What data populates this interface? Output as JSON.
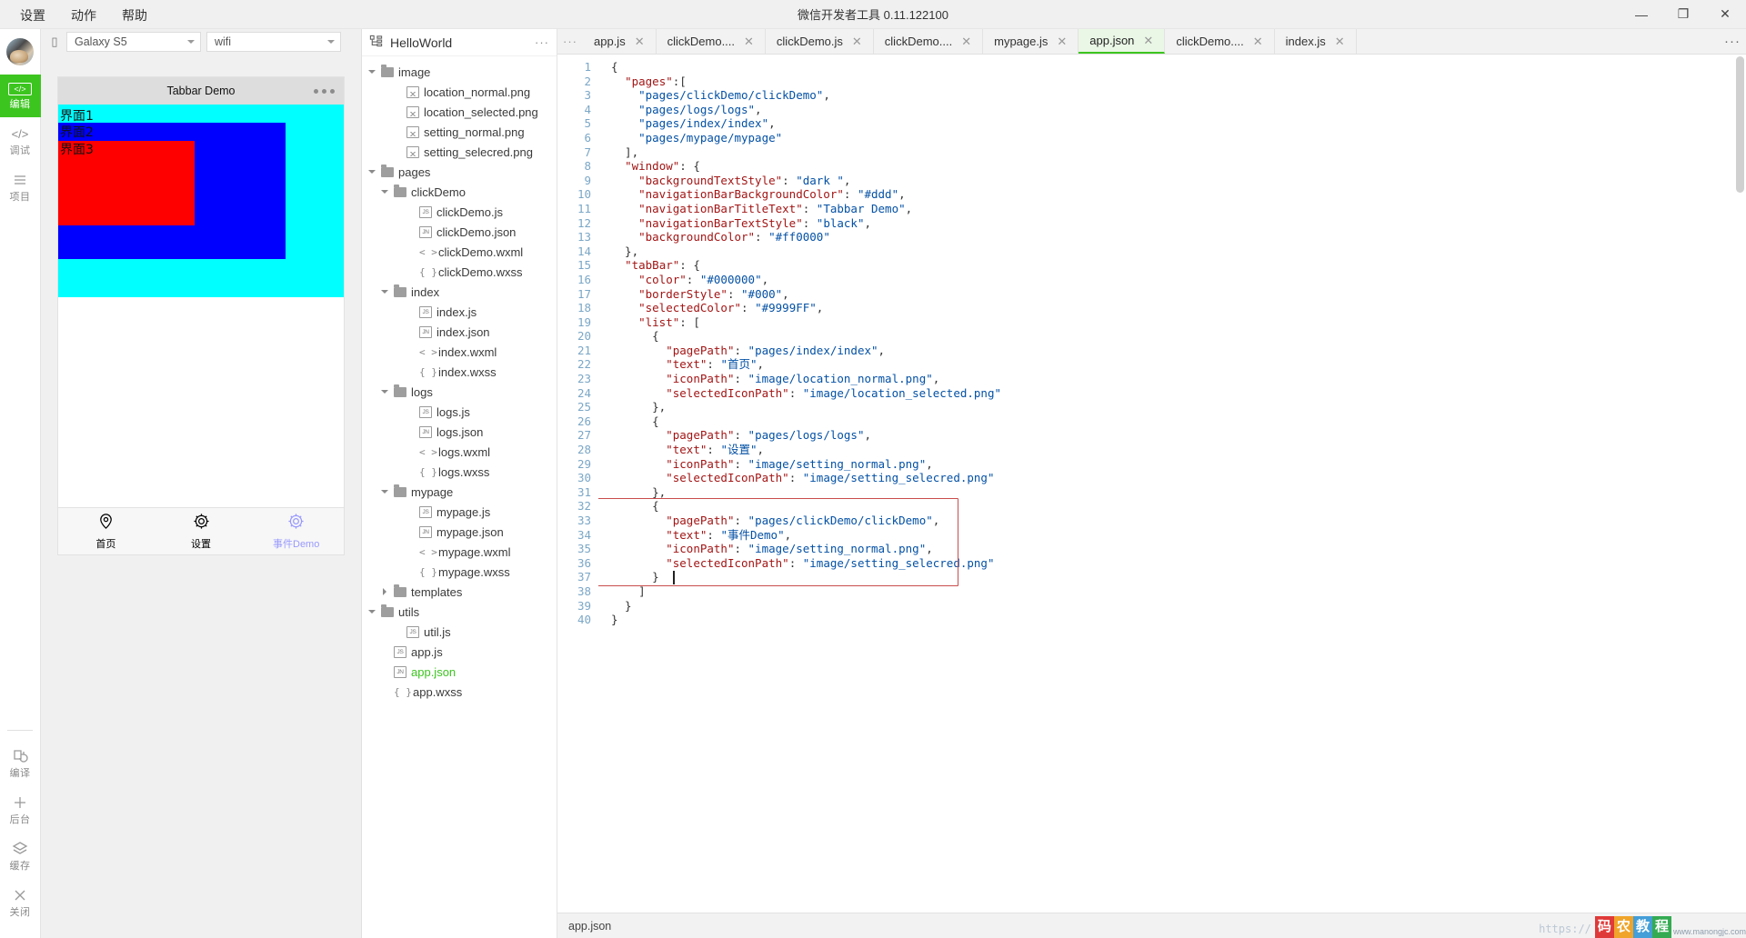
{
  "window": {
    "title": "微信开发者工具 0.11.122100",
    "controls": {
      "minimize": "—",
      "maximize": "❐",
      "close": "✕"
    }
  },
  "menubar": {
    "items": [
      "设置",
      "动作",
      "帮助"
    ]
  },
  "rail": {
    "items": [
      {
        "label": "编辑",
        "icon": "code-brackets-icon",
        "active": true
      },
      {
        "label": "调试",
        "icon": "debug-icon",
        "active": false
      },
      {
        "label": "项目",
        "icon": "project-list-icon",
        "active": false
      }
    ],
    "bottom_items": [
      {
        "label": "编译",
        "icon": "compile-refresh-icon"
      },
      {
        "label": "后台",
        "icon": "background-icon"
      },
      {
        "label": "缓存",
        "icon": "cache-layers-icon"
      },
      {
        "label": "关闭",
        "icon": "close-x-icon"
      }
    ]
  },
  "simulator": {
    "device": "Galaxy S5",
    "network": "wifi",
    "nav_title": "Tabbar Demo",
    "page_labels": [
      "界面1",
      "界面2",
      "界面3"
    ],
    "colors": {
      "cyan": "#00ffff",
      "blue": "#0000ff",
      "red": "#ff0000",
      "nav_bg": "#dddddd"
    },
    "tabbar": [
      {
        "text": "首页",
        "icon": "location-pin-icon",
        "selected": false
      },
      {
        "text": "设置",
        "icon": "gear-icon",
        "selected": false
      },
      {
        "text": "事件Demo",
        "icon": "gear-icon",
        "selected": true
      }
    ],
    "tabbar_selected_color": "#9999FF"
  },
  "tree": {
    "project_name": "HelloWorld",
    "more_label": "···",
    "nodes": [
      {
        "label": "image",
        "type": "folder",
        "depth": 0,
        "expanded": true
      },
      {
        "label": "location_normal.png",
        "type": "image",
        "depth": 2
      },
      {
        "label": "location_selected.png",
        "type": "image",
        "depth": 2
      },
      {
        "label": "setting_normal.png",
        "type": "image",
        "depth": 2
      },
      {
        "label": "setting_selecred.png",
        "type": "image",
        "depth": 2
      },
      {
        "label": "pages",
        "type": "folder",
        "depth": 0,
        "expanded": true
      },
      {
        "label": "clickDemo",
        "type": "folder",
        "depth": 1,
        "expanded": true
      },
      {
        "label": "clickDemo.js",
        "type": "js",
        "depth": 3
      },
      {
        "label": "clickDemo.json",
        "type": "jn",
        "depth": 3
      },
      {
        "label": "clickDemo.wxml",
        "type": "wxml",
        "depth": 3
      },
      {
        "label": "clickDemo.wxss",
        "type": "wxss",
        "depth": 3
      },
      {
        "label": "index",
        "type": "folder",
        "depth": 1,
        "expanded": true
      },
      {
        "label": "index.js",
        "type": "js",
        "depth": 3
      },
      {
        "label": "index.json",
        "type": "jn",
        "depth": 3
      },
      {
        "label": "index.wxml",
        "type": "wxml",
        "depth": 3
      },
      {
        "label": "index.wxss",
        "type": "wxss",
        "depth": 3
      },
      {
        "label": "logs",
        "type": "folder",
        "depth": 1,
        "expanded": true
      },
      {
        "label": "logs.js",
        "type": "js",
        "depth": 3
      },
      {
        "label": "logs.json",
        "type": "jn",
        "depth": 3
      },
      {
        "label": "logs.wxml",
        "type": "wxml",
        "depth": 3
      },
      {
        "label": "logs.wxss",
        "type": "wxss",
        "depth": 3
      },
      {
        "label": "mypage",
        "type": "folder",
        "depth": 1,
        "expanded": true
      },
      {
        "label": "mypage.js",
        "type": "js",
        "depth": 3
      },
      {
        "label": "mypage.json",
        "type": "jn",
        "depth": 3
      },
      {
        "label": "mypage.wxml",
        "type": "wxml",
        "depth": 3
      },
      {
        "label": "mypage.wxss",
        "type": "wxss",
        "depth": 3
      },
      {
        "label": "templates",
        "type": "folder",
        "depth": 1,
        "expanded": false
      },
      {
        "label": "utils",
        "type": "folder",
        "depth": 0,
        "expanded": true
      },
      {
        "label": "util.js",
        "type": "js",
        "depth": 2
      },
      {
        "label": "app.js",
        "type": "js",
        "depth": 1
      },
      {
        "label": "app.json",
        "type": "jn",
        "depth": 1,
        "selected": true
      },
      {
        "label": "app.wxss",
        "type": "wxss",
        "depth": 1
      }
    ]
  },
  "editor": {
    "more_left": "···",
    "more_right": "···",
    "tabs": [
      {
        "label": "app.js",
        "active": false
      },
      {
        "label": "clickDemo....",
        "active": false
      },
      {
        "label": "clickDemo.js",
        "active": false
      },
      {
        "label": "clickDemo....",
        "active": false
      },
      {
        "label": "mypage.js",
        "active": false
      },
      {
        "label": "app.json",
        "active": true
      },
      {
        "label": "clickDemo....",
        "active": false
      },
      {
        "label": "index.js",
        "active": false
      }
    ],
    "close_glyph": "✕",
    "lines": [
      "{",
      "  \"pages\":[",
      "    \"pages/clickDemo/clickDemo\",",
      "    \"pages/logs/logs\",",
      "    \"pages/index/index\",",
      "    \"pages/mypage/mypage\"",
      "  ],",
      "  \"window\": {",
      "    \"backgroundTextStyle\": \"dark \",",
      "    \"navigationBarBackgroundColor\": \"#ddd\",",
      "    \"navigationBarTitleText\": \"Tabbar Demo\",",
      "    \"navigationBarTextStyle\": \"black\",",
      "    \"backgroundColor\": \"#ff0000\"",
      "  },",
      "  \"tabBar\": {",
      "    \"color\": \"#000000\",",
      "    \"borderStyle\": \"#000\",",
      "    \"selectedColor\": \"#9999FF\",",
      "    \"list\": [",
      "      {",
      "        \"pagePath\": \"pages/index/index\",",
      "        \"text\": \"首页\",",
      "        \"iconPath\": \"image/location_normal.png\",",
      "        \"selectedIconPath\": \"image/location_selected.png\"",
      "      },",
      "      {",
      "        \"pagePath\": \"pages/logs/logs\",",
      "        \"text\": \"设置\",",
      "        \"iconPath\": \"image/setting_normal.png\",",
      "        \"selectedIconPath\": \"image/setting_selecred.png\"",
      "      },",
      "      {",
      "        \"pagePath\": \"pages/clickDemo/clickDemo\",",
      "        \"text\": \"事件Demo\",",
      "        \"iconPath\": \"image/setting_normal.png\",",
      "        \"selectedIconPath\": \"image/setting_selecred.png\"",
      "      }",
      "    ]",
      "  }",
      "}"
    ],
    "total_lines": 40,
    "selection_start_line": 32,
    "selection_end_line": 37,
    "selection_border_color": "#c94c4c"
  },
  "status": {
    "file": "app.json",
    "watermark_url": "https://",
    "watermark_text": "码农教程",
    "watermark_sub": "www.manongjc.com"
  }
}
